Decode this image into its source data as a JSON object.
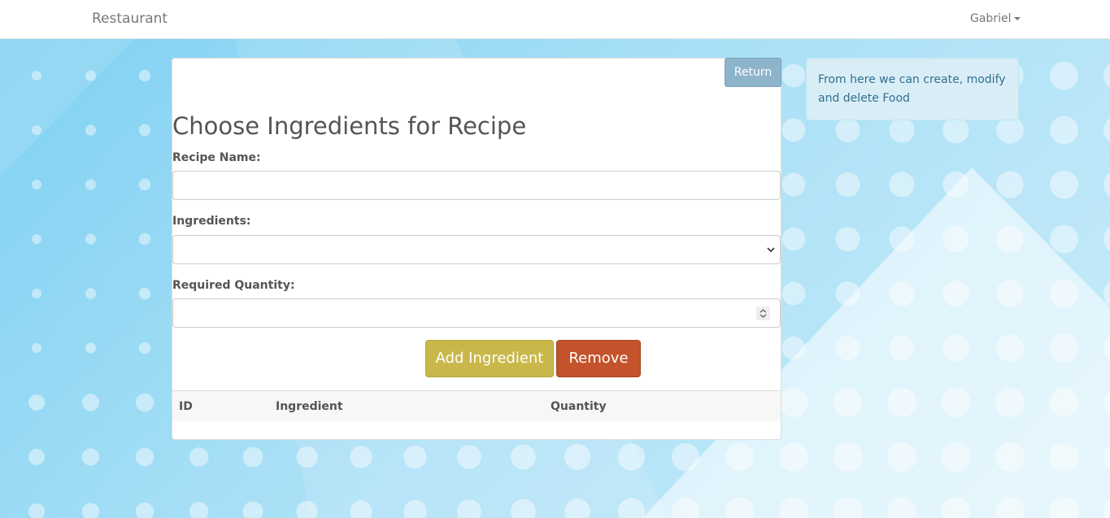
{
  "navbar": {
    "brand": "Restaurant",
    "user": "Gabriel"
  },
  "panel": {
    "return_label": "Return",
    "title": "Choose Ingredients for Recipe",
    "recipe_name_label": "Recipe Name:",
    "recipe_name_value": "",
    "ingredients_label": "Ingredients:",
    "ingredients_selected": "",
    "quantity_label": "Required Quantity:",
    "quantity_value": "",
    "add_label": "Add Ingredient",
    "remove_label": "Remove",
    "table": {
      "columns": [
        "ID",
        "Ingredient",
        "Quantity"
      ],
      "rows": []
    }
  },
  "info": {
    "text": "From here we can create, modify and delete Food"
  },
  "colors": {
    "add_button": "#c9b74a",
    "remove_button": "#c4522b",
    "return_button": "#8eb4cb",
    "info_background": "#d9edf7",
    "info_text": "#31708f"
  }
}
